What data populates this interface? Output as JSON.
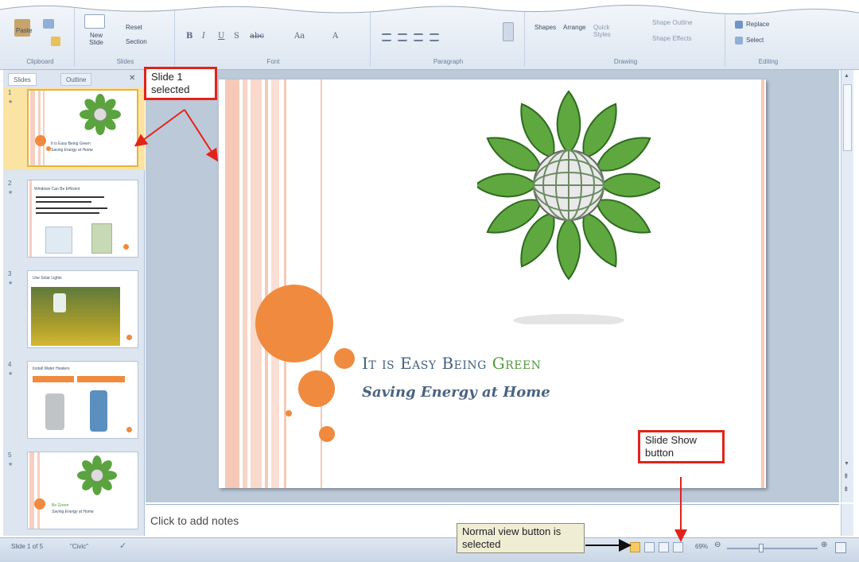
{
  "ribbon": {
    "clipboard": {
      "paste": "Paste",
      "label": "Clipboard"
    },
    "slides": {
      "new_slide": "New Slide",
      "reset": "Reset",
      "section": "Section",
      "label": "Slides"
    },
    "font": {
      "label": "Font"
    },
    "paragraph": {
      "label": "Paragraph"
    },
    "drawing": {
      "shapes": "Shapes",
      "arrange": "Arrange",
      "quick_styles": "Quick Styles",
      "shape_outline": "Shape Outline",
      "shape_effects": "Shape Effects",
      "label": "Drawing"
    },
    "editing": {
      "replace": "Replace",
      "select": "Select",
      "label": "Editing"
    }
  },
  "left_pane": {
    "tabs": [
      "Slides",
      "Outline"
    ],
    "thumbnails": [
      {
        "number": "1",
        "title": "It is Easy Being Green",
        "subtitle": "Saving Energy at Home"
      },
      {
        "number": "2",
        "title": "Windows Can Be Efficient"
      },
      {
        "number": "3",
        "title": "Use Solar Lights"
      },
      {
        "number": "4",
        "title": "Install Water Heaters"
      },
      {
        "number": "5",
        "title": "Be Green",
        "subtitle": "Saving Energy at Home"
      }
    ]
  },
  "slide": {
    "title_part1": "It is Easy Being ",
    "title_part2": "Green",
    "subtitle": "Saving Energy at Home"
  },
  "notes": {
    "placeholder": "Click to add notes"
  },
  "status_bar": {
    "slide_info": "Slide 1 of 5",
    "theme": "\"Civic\"",
    "zoom": "69%"
  },
  "callouts": {
    "slide1_selected": "Slide 1 selected",
    "slide_show_button": "Slide Show button",
    "normal_view": "Normal view button is selected"
  },
  "colors": {
    "accent_orange": "#f08a3e",
    "callout_red": "#e2231a",
    "title_green": "#4f9a3c"
  }
}
